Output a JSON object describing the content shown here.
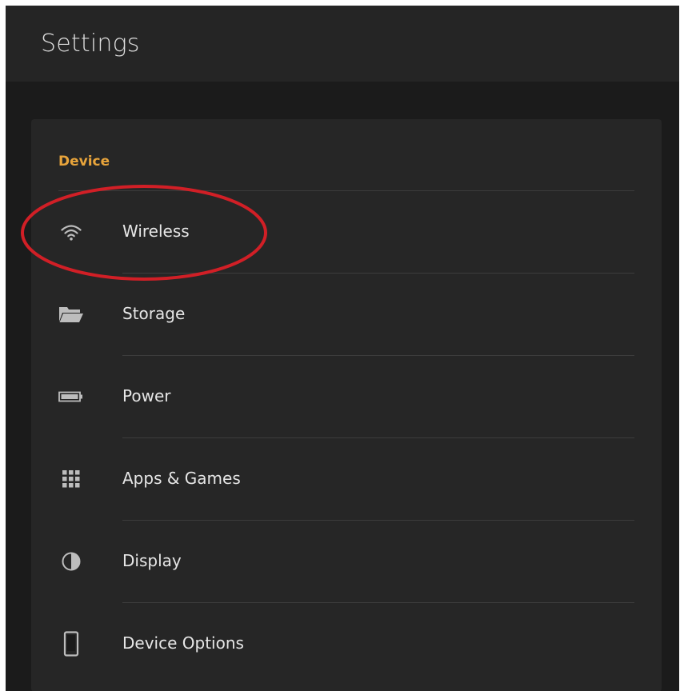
{
  "header": {
    "title": "Settings"
  },
  "section": {
    "title": "Device",
    "accent_color": "#e8a43b"
  },
  "items": [
    {
      "label": "Wireless",
      "icon": "wifi-icon"
    },
    {
      "label": "Storage",
      "icon": "folder-icon"
    },
    {
      "label": "Power",
      "icon": "battery-icon"
    },
    {
      "label": "Apps & Games",
      "icon": "grid-icon"
    },
    {
      "label": "Display",
      "icon": "contrast-icon"
    },
    {
      "label": "Device Options",
      "icon": "device-icon"
    }
  ],
  "annotation": {
    "highlight_color": "#d11f26",
    "highlighted_item": "Wireless"
  }
}
